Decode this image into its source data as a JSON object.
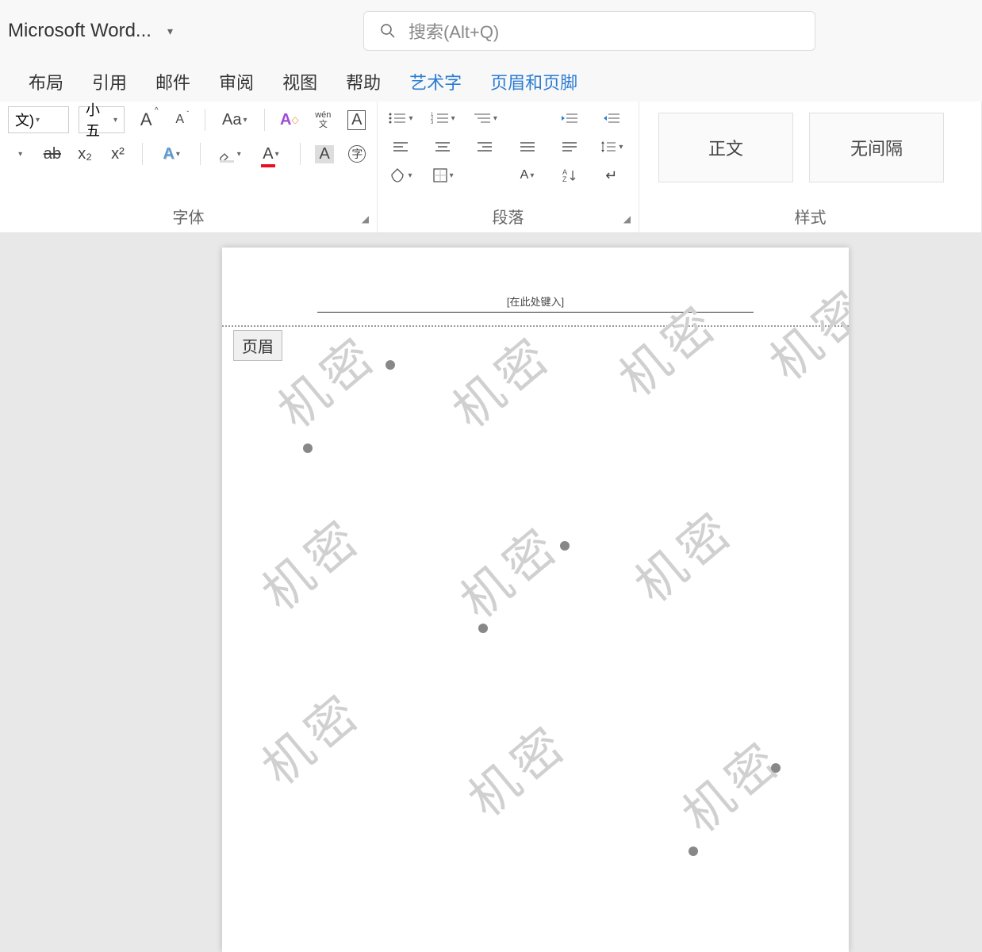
{
  "title": "Microsoft Word...",
  "search": {
    "placeholder": "搜索(Alt+Q)"
  },
  "menu": {
    "items": [
      "布局",
      "引用",
      "邮件",
      "审阅",
      "视图",
      "帮助"
    ],
    "contextual": [
      "艺术字",
      "页眉和页脚"
    ]
  },
  "ribbon": {
    "font": {
      "label": "字体",
      "font_name": "文)",
      "font_size": "小五",
      "phonetic": "wén 文",
      "grow": "A",
      "shrink": "A",
      "case": "Aa",
      "strike": "ab",
      "sub": "x₂",
      "sup": "x²",
      "char_border": "A",
      "circle": "字",
      "clear_fmt": "A"
    },
    "paragraph": {
      "label": "段落"
    },
    "styles": {
      "label": "样式",
      "items": [
        "正文",
        "无间隔"
      ]
    }
  },
  "document": {
    "header_placeholder": "[在此处键入]",
    "header_tag": "页眉",
    "watermark_text": "机密"
  }
}
